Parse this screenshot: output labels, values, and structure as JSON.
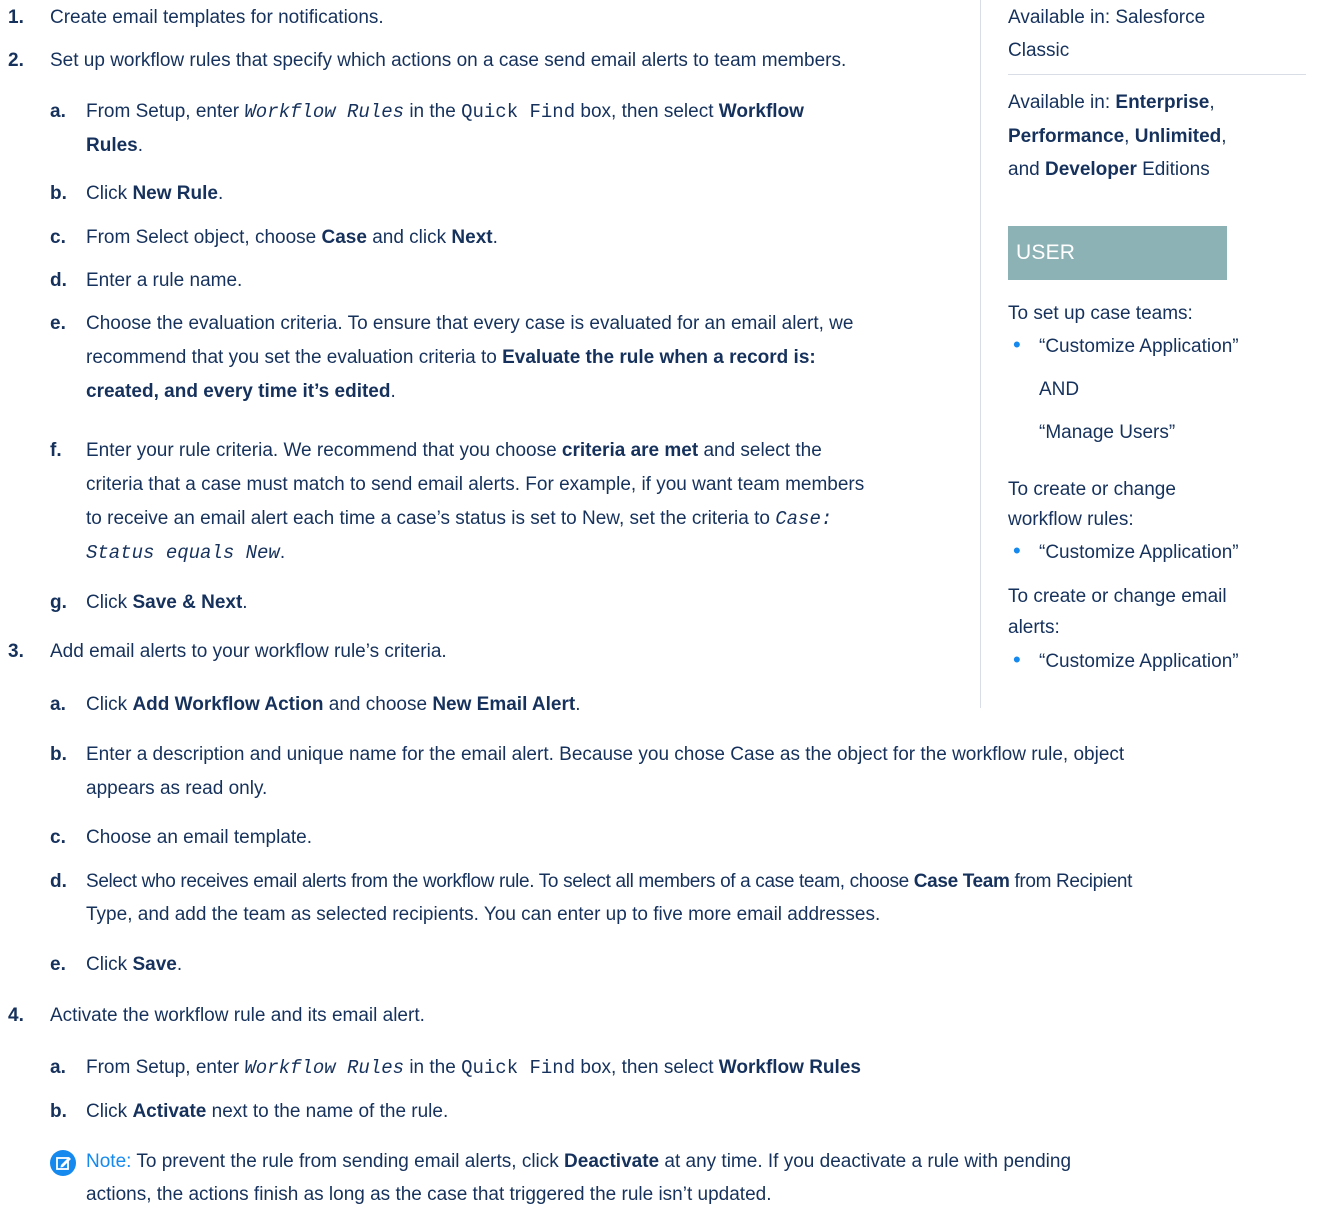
{
  "steps": [
    {
      "num": "1.",
      "text": "Create email templates for notifications."
    },
    {
      "num": "2.",
      "text": "Set up workflow rules that specify which actions on a case send email alerts to team members."
    },
    {
      "num": "3.",
      "text": "Add email alerts to your workflow rule’s criteria."
    },
    {
      "num": "4.",
      "text": "Activate the workflow rule and its email alert."
    }
  ],
  "step2": {
    "a": {
      "l": "a.",
      "p1": "From Setup, enter ",
      "code1": "Workflow Rules",
      "p2": " in the ",
      "code2": "Quick Find",
      "p3": " box, then select ",
      "b1": "Workflow",
      "b2": "Rules",
      "p4": "."
    },
    "b": {
      "l": "b.",
      "p1": "Click ",
      "b1": "New Rule",
      "p2": "."
    },
    "c": {
      "l": "c.",
      "p1": "From Select object, choose ",
      "b1": "Case",
      "p2": " and click ",
      "b2": "Next",
      "p3": "."
    },
    "d": {
      "l": "d.",
      "p1": "Enter a rule name."
    },
    "e": {
      "l": "e.",
      "line1": "Choose the evaluation criteria. To ensure that every case is evaluated for an email alert, we",
      "line2p": "recommend that you set the evaluation criteria to ",
      "line2b": "Evaluate the rule when a record is:",
      "line3b": "created, and every time it’s edited",
      "line3p": "."
    },
    "f": {
      "l": "f.",
      "line1p": "Enter your rule criteria. We recommend that you choose ",
      "line1b": "criteria are met",
      "line1q": " and select the",
      "line2": "criteria that a case must match to send email alerts. For example, if you want team members",
      "line3p": "to receive an email alert each time a case’s status is set to New, set the criteria to ",
      "line3c": "Case:",
      "line4c": "Status equals New",
      "line4p": "."
    },
    "g": {
      "l": "g.",
      "p1": "Click ",
      "b1": "Save & Next",
      "p2": "."
    }
  },
  "step3": {
    "a": {
      "l": "a.",
      "p1": "Click ",
      "b1": "Add Workflow Action",
      "p2": " and choose ",
      "b2": "New Email Alert",
      "p3": "."
    },
    "b": {
      "l": "b.",
      "line1": "Enter a description and unique name for the email alert. Because you chose Case as the object for the workflow rule, object",
      "line2": "appears as read only."
    },
    "c": {
      "l": "c.",
      "p1": "Choose an email template."
    },
    "d": {
      "l": "d.",
      "line1p": "Select who receives email alerts from the workflow rule. To select all members of a case team, choose ",
      "line1b": "Case Team",
      "line1q": " from Recipient",
      "line2": "Type, and add the team as selected recipients. You can enter up to five more email addresses."
    },
    "e": {
      "l": "e.",
      "p1": "Click ",
      "b1": "Save",
      "p2": "."
    }
  },
  "step4": {
    "a": {
      "l": "a.",
      "p1": "From Setup, enter ",
      "code1": "Workflow Rules",
      "p2": " in the ",
      "code2": "Quick Find",
      "p3": " box, then select ",
      "b1": "Workflow Rules"
    },
    "b": {
      "l": "b.",
      "p1": "Click ",
      "b1": "Activate",
      "p2": " next to the name of the rule."
    }
  },
  "note": {
    "label": "Note:",
    "line1p": " To prevent the rule from sending email alerts, click ",
    "line1b": "Deactivate",
    "line1q": " at any time. If you deactivate a rule with pending",
    "line2": "actions, the actions finish as long as the case that triggered the rule isn’t updated."
  },
  "sidebar": {
    "avail1_l1": "Available in: Salesforce",
    "avail1_l2": "Classic",
    "avail2_l1p": "Available in: ",
    "avail2_l1b": "Enterprise",
    "avail2_l1q": ",",
    "avail2_l2b1": "Performance",
    "avail2_l2p": ", ",
    "avail2_l2b2": "Unlimited",
    "avail2_l2q": ",",
    "avail2_l3p": "and ",
    "avail2_l3b": "Developer",
    "avail2_l3q": " Editions",
    "perm_title": "USER PERMISSIONS",
    "perm1_title": "To set up case teams:",
    "perm1_b1": "“Customize Application”",
    "perm1_and": "AND",
    "perm1_b2": "“Manage Users”",
    "perm2_l1": "To create or change",
    "perm2_l2": "workflow rules:",
    "perm2_b1": "“Customize Application”",
    "perm3_l1": "To create or change email",
    "perm3_l2": "alerts:",
    "perm3_b1": "“Customize Application”",
    "bullet": "•"
  },
  "colors": {
    "text": "#16325c",
    "accent": "#1589ee",
    "badge": "#8cb2b5"
  }
}
